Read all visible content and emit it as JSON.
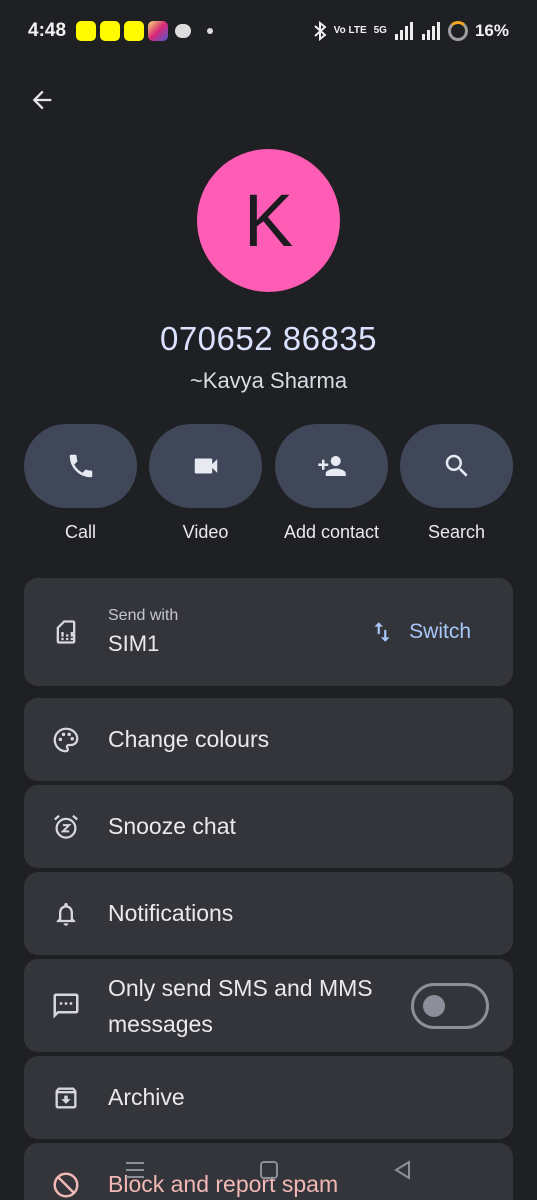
{
  "status_bar": {
    "time": "4:48",
    "network_volte": "Vo LTE",
    "network_5g": "5G",
    "battery": "16%"
  },
  "contact": {
    "initial": "K",
    "phone": "070652 86835",
    "name": "~Kavya Sharma",
    "avatar_color": "#ff5cb5"
  },
  "actions": [
    {
      "label": "Call",
      "icon": "phone-icon"
    },
    {
      "label": "Video",
      "icon": "video-icon"
    },
    {
      "label": "Add contact",
      "icon": "add-person-icon"
    },
    {
      "label": "Search",
      "icon": "search-icon"
    }
  ],
  "send_with": {
    "label": "Send with",
    "value": "SIM1",
    "switch_label": "Switch"
  },
  "menu": {
    "change_colours": "Change colours",
    "snooze_chat": "Snooze chat",
    "notifications": "Notifications",
    "sms_mms": "Only send SMS and MMS messages",
    "sms_mms_enabled": false,
    "archive": "Archive",
    "block_spam": "Block and report spam"
  },
  "colors": {
    "accent": "#a8c7fa",
    "danger": "#f2b8b5",
    "card": "#34353a",
    "action_pill": "#3f4759"
  }
}
